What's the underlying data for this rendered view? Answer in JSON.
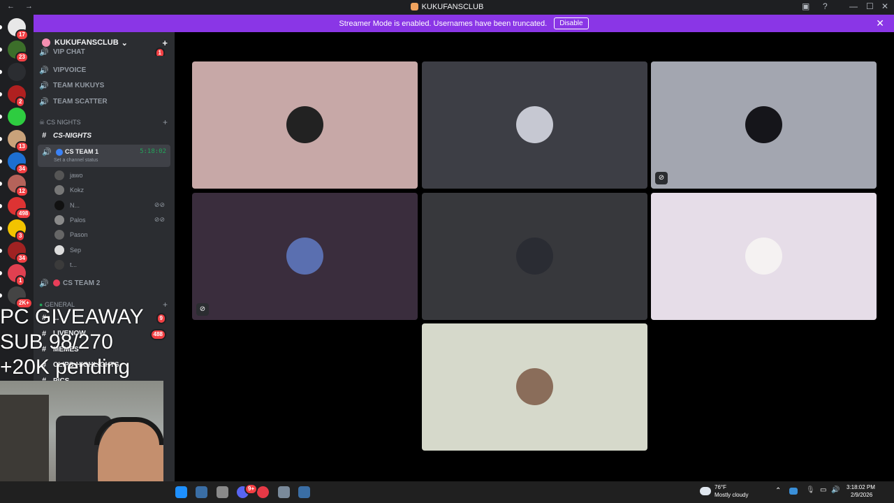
{
  "titlebar": {
    "nav": "← →",
    "title": "KUKUFANSCLUB",
    "inbox": "▣",
    "help": "?",
    "minimize": "—",
    "maximize": "☐",
    "close": "✕"
  },
  "banner": {
    "text": "Streamer Mode is enabled. Usernames have been truncated.",
    "button": "Disable",
    "close": "✕"
  },
  "servers": [
    {
      "badge": "17",
      "color": "#e8e8e8"
    },
    {
      "badge": "23",
      "color": "#3c6e2a"
    },
    {
      "badge": "",
      "color": "#2b2d31"
    },
    {
      "badge": "2",
      "color": "#b02020"
    },
    {
      "badge": "",
      "color": "#2ecc40"
    },
    {
      "badge": "13",
      "color": "#c9a27a"
    },
    {
      "badge": "34",
      "color": "#1d6fd1"
    },
    {
      "badge": "12",
      "color": "#b5635a"
    },
    {
      "badge": "498",
      "color": "#d33"
    },
    {
      "badge": "3",
      "color": "#f2c300"
    },
    {
      "badge": "34",
      "color": "#a02222"
    },
    {
      "badge": "1",
      "color": "#e04050"
    },
    {
      "badge": "2K+",
      "color": "#444"
    }
  ],
  "sidebar": {
    "server_name": "KUKUFANSCLUB",
    "chevron": "⌄",
    "invite_icon": "+",
    "top_channels": [
      {
        "name": "VIP CHAT",
        "badge": "1"
      },
      {
        "name": "VIPVOICE"
      },
      {
        "name": "TEAM KUKUYS"
      },
      {
        "name": "TEAM SCATTER"
      }
    ],
    "category_cs": "CS NIGHTS",
    "text_cs": "CS-NIGHTS",
    "voice_active": {
      "name": "CS TEAM 1",
      "timer": "5:18:02",
      "status": "Set a channel status"
    },
    "members": [
      "jawo",
      "Kokz",
      "N...",
      "Palos",
      "Pason",
      "Sep",
      "t..."
    ],
    "voice_2": "CS TEAM 2",
    "category_general": "GENERAL",
    "general_channels": [
      {
        "name": "...",
        "badge": "9"
      },
      {
        "name": "LIVENOW",
        "badge": "488"
      },
      {
        "name": "MEMES"
      },
      {
        "name": "CLIPS-HIGHLIGHTS"
      },
      {
        "name": "PICS"
      }
    ],
    "add": "+"
  },
  "overlay": {
    "line1": "PC GIVEAWAY",
    "line2": "SUB 98/270",
    "line3": "+20K pending"
  },
  "tiles": [
    {
      "bg": "#c7a8a7",
      "av": "#222",
      "muted": false
    },
    {
      "bg": "#3d3e45",
      "av": "#c6c8d2",
      "muted": false
    },
    {
      "bg": "#a3a6b0",
      "av": "#15151a",
      "muted": true
    },
    {
      "bg": "#3a2d3d",
      "av": "#5a6fb0",
      "muted": true
    },
    {
      "bg": "#37383c",
      "av": "#2a2c33",
      "muted": false
    },
    {
      "bg": "#e6dde8",
      "av": "#f5f2f2",
      "muted": false
    },
    {
      "bg": "#d6d9cb",
      "av": "#8a6d5a",
      "muted": false
    }
  ],
  "taskbar": {
    "weather_temp": "76°F",
    "weather_desc": "Mostly cloudy",
    "time": "3:18:02 PM",
    "date": "2/9/2026",
    "icons": [
      "#1e90ff",
      "#3a6ea5",
      "#8a8a8a",
      "#5865f2",
      "#e63946",
      "#7a8a9a",
      "#3a6ea5"
    ],
    "discord_badge": "9+"
  },
  "colors": {
    "accent": "#8a36e6",
    "voice_green": "#23a55a",
    "badge_red": "#f23f43"
  }
}
